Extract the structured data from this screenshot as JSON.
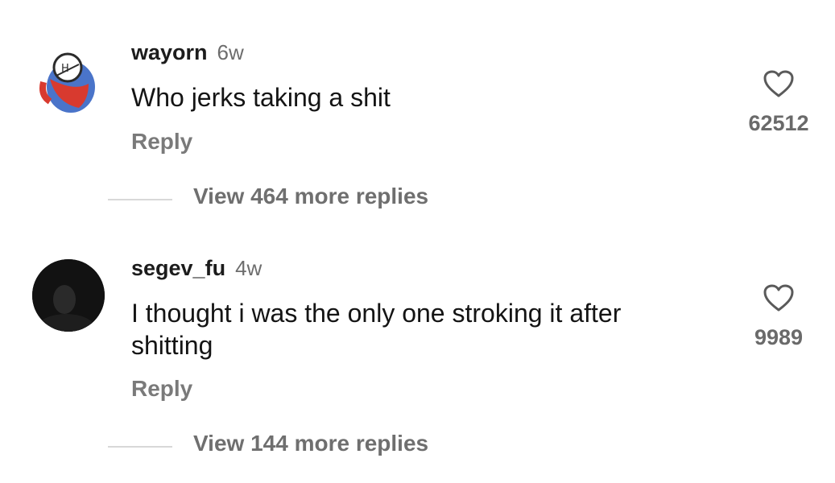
{
  "comments": [
    {
      "username": "wayorn",
      "time": "6w",
      "text": "Who jerks taking a shit",
      "reply_label": "Reply",
      "likes": "62512",
      "view_replies": "View 464 more replies",
      "avatar_icon": "cartoon-character-avatar"
    },
    {
      "username": "segev_fu",
      "time": "4w",
      "text": "I thought i was the only one stroking it after shitting",
      "reply_label": "Reply",
      "likes": "9989",
      "view_replies": "View 144 more replies",
      "avatar_icon": "dark-photo-avatar"
    }
  ],
  "icons": {
    "like": "heart-outline-icon"
  },
  "colors": {
    "text": "#141414",
    "muted": "#6d6d6d",
    "divider": "#d8d8d8"
  }
}
